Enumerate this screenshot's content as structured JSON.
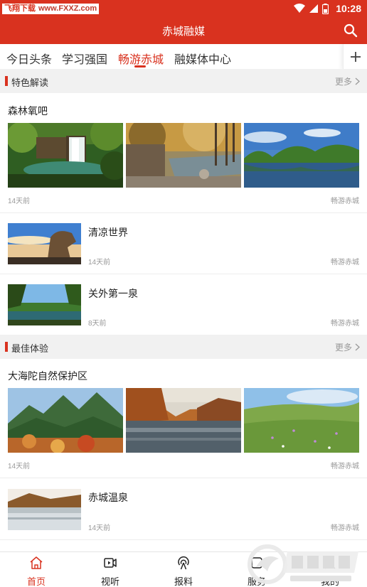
{
  "status_bar": {
    "watermark_left": "飞翔下载",
    "watermark_right": "www.FXXZ.com",
    "time": "10:28",
    "icons": [
      "wifi-icon",
      "signal-icon",
      "battery-icon"
    ]
  },
  "app_bar": {
    "title": "赤城融媒",
    "search_icon": "search-icon"
  },
  "tabs": {
    "items": [
      "今日头条",
      "学习强国",
      "畅游赤城",
      "融媒体中心"
    ],
    "active_index": 2,
    "add_icon": "plus-icon"
  },
  "sections": [
    {
      "title": "特色解读",
      "more": "更多",
      "items": [
        {
          "title": "森林氧吧",
          "time": "14天前",
          "source": "畅游赤城",
          "images": [
            "waterfall",
            "autumn-river",
            "lake-trees"
          ]
        },
        {
          "title": "清凉世界",
          "time": "14天前",
          "source": "畅游赤城",
          "images": [
            "rock-sky"
          ]
        },
        {
          "title": "关外第一泉",
          "time": "8天前",
          "source": "畅游赤城",
          "images": [
            "pine-lake"
          ]
        }
      ]
    },
    {
      "title": "最佳体验",
      "more": "更多",
      "items": [
        {
          "title": "大海陀自然保护区",
          "time": "14天前",
          "source": "畅游赤城",
          "images": [
            "green-mountains",
            "autumn-lake",
            "grassland"
          ]
        },
        {
          "title": "赤城温泉",
          "time": "14天前",
          "source": "畅游赤城",
          "images": [
            "hot-spring"
          ]
        }
      ]
    }
  ],
  "bottom_nav": {
    "items": [
      {
        "label": "首页",
        "icon": "home-icon"
      },
      {
        "label": "视听",
        "icon": "video-icon"
      },
      {
        "label": "报料",
        "icon": "broadcast-icon"
      },
      {
        "label": "服务",
        "icon": "service-icon"
      },
      {
        "label": "我的",
        "icon": "user-icon"
      }
    ],
    "active_index": 0
  },
  "brand_watermark": {
    "name": "飞翔下载",
    "url": "www.fxxz.com"
  },
  "colors": {
    "accent": "#d9321f",
    "meta": "#999999",
    "section_bg": "#f1f1f1"
  }
}
